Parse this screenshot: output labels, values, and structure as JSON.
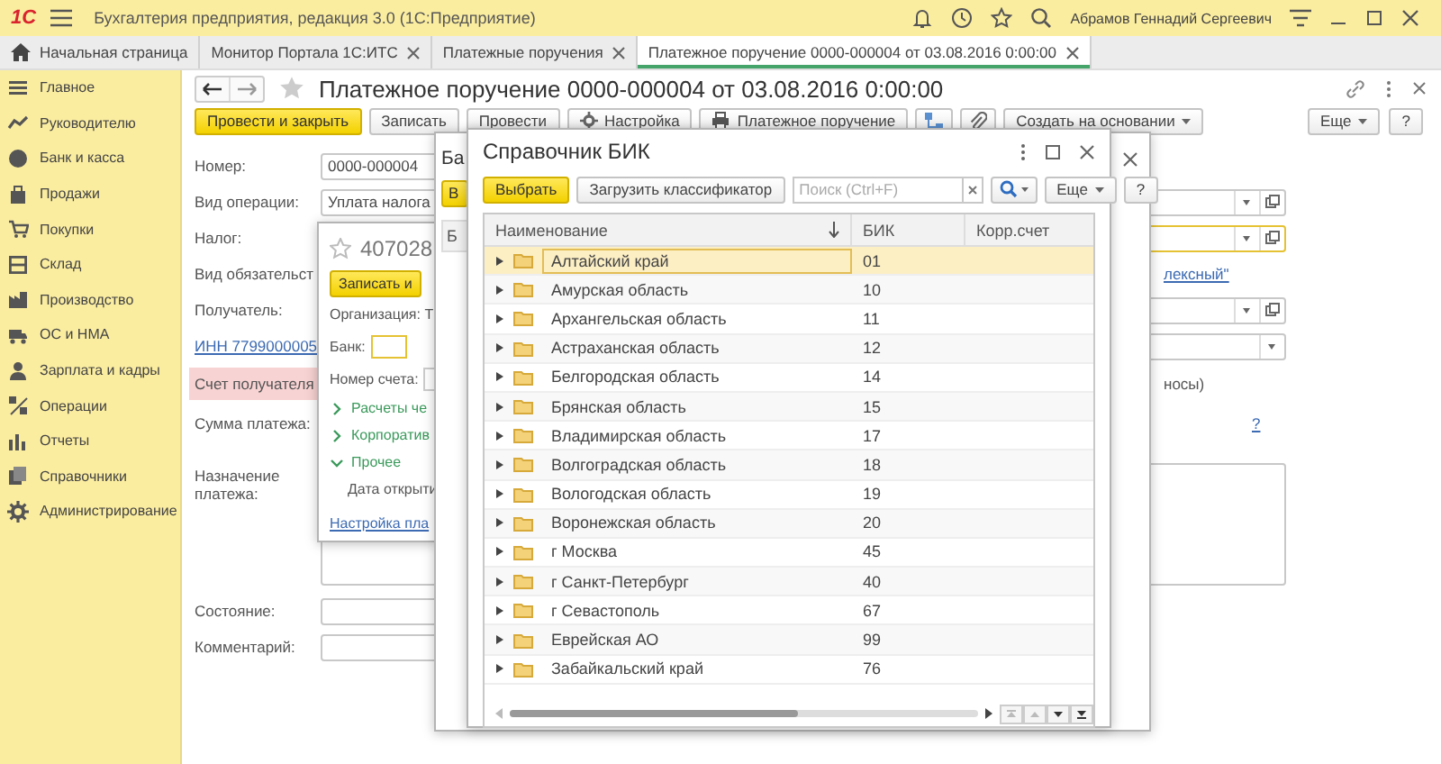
{
  "app": {
    "logo": "1С",
    "title": "Бухгалтерия предприятия, редакция 3.0  (1С:Предприятие)",
    "user": "Абрамов Геннадий Сергеевич"
  },
  "tabs": [
    {
      "label": "Начальная страница",
      "kind": "home",
      "selected": false
    },
    {
      "label": "Монитор Портала 1С:ИТС",
      "kind": "closable",
      "selected": false
    },
    {
      "label": "Платежные поручения",
      "kind": "closable",
      "selected": false
    },
    {
      "label": "Платежное поручение 0000-000004 от 03.08.2016 0:00:00",
      "kind": "closable",
      "selected": true
    }
  ],
  "sidebar": {
    "items": [
      {
        "label": "Главное"
      },
      {
        "label": "Руководителю"
      },
      {
        "label": "Банк и касса"
      },
      {
        "label": "Продажи"
      },
      {
        "label": "Покупки"
      },
      {
        "label": "Склад"
      },
      {
        "label": "Производство"
      },
      {
        "label": "ОС и НМА"
      },
      {
        "label": "Зарплата и кадры"
      },
      {
        "label": "Операции"
      },
      {
        "label": "Отчеты"
      },
      {
        "label": "Справочники"
      },
      {
        "label": "Администрирование"
      }
    ]
  },
  "document": {
    "title": "Платежное поручение 0000-000004 от 03.08.2016 0:00:00",
    "favorite": false,
    "toolbar": [
      {
        "label": "Провести и закрыть",
        "kind": "primary"
      },
      {
        "label": "Записать",
        "kind": "plain"
      },
      {
        "label": "Провести",
        "kind": "plain"
      },
      {
        "label": "Настройка",
        "kind": "gear"
      },
      {
        "label": "Платежное поручение",
        "kind": "print"
      },
      {
        "kind": "structure"
      },
      {
        "kind": "clip"
      },
      {
        "label": "Создать на основании",
        "kind": "menu"
      }
    ],
    "toolbar_right": [
      {
        "label": "Еще",
        "kind": "menu"
      },
      {
        "label": "?",
        "kind": "plain"
      }
    ],
    "fields": [
      {
        "kind": "input",
        "label": "Номер:",
        "value": "0000-000004"
      },
      {
        "kind": "select",
        "label": "Вид операции:",
        "value": "Уплата налога",
        "focused": false
      },
      {
        "kind": "select",
        "label": "Налог:",
        "focused": true
      },
      {
        "kind": "link",
        "label": "Вид обязательст",
        "link": "лексный\""
      },
      {
        "kind": "select",
        "label": "Получатель:",
        "focused": false
      },
      {
        "kind": "inn",
        "label": "ИНН 7799000005"
      },
      {
        "kind": "warning",
        "label": "Счет получателя",
        "note": "носы)"
      },
      {
        "kind": "help",
        "label": "Сумма платежа:",
        "help": "?"
      },
      {
        "kind": "textarea",
        "label": "Назначение платежа:"
      },
      {
        "kind": "short",
        "label": "Состояние:"
      },
      {
        "kind": "short",
        "label": "Комментарий:"
      }
    ]
  },
  "account_window": {
    "title": "407028",
    "button": "Записать и",
    "fields": [
      {
        "kind": "text",
        "label": "Организация: Т"
      },
      {
        "kind": "input",
        "label": "Банк:",
        "focused": true
      },
      {
        "kind": "input",
        "label": "Номер счета:",
        "focused": false
      }
    ],
    "groups": [
      {
        "label": "Расчеты че",
        "expanded": false
      },
      {
        "label": "Корпоратив",
        "expanded": false
      },
      {
        "label": "Прочее",
        "expanded": true,
        "children": [
          {
            "label": "Дата открыти"
          }
        ]
      }
    ],
    "link": "Настройка пла"
  },
  "bank_window": {
    "title": "Ба",
    "button": "В",
    "column": "Б"
  },
  "bik_window": {
    "title": "Справочник БИК",
    "buttons": [
      {
        "label": "Выбрать",
        "kind": "primary"
      },
      {
        "label": "Загрузить классификатор",
        "kind": "plain"
      }
    ],
    "search": {
      "placeholder": "Поиск (Ctrl+F)"
    },
    "tools": [
      {
        "label": "Еще",
        "kind": "menu"
      },
      {
        "label": "?",
        "kind": "plain"
      }
    ],
    "columns": [
      {
        "label": "Наименование",
        "sorted": true
      },
      {
        "label": "БИК",
        "sorted": false
      },
      {
        "label": "Корр.счет",
        "sorted": false
      }
    ],
    "rows": [
      {
        "name": "Алтайский край",
        "bik": "01",
        "selected": true
      },
      {
        "name": "Амурская область",
        "bik": "10",
        "selected": false
      },
      {
        "name": "Архангельская область",
        "bik": "11",
        "selected": false
      },
      {
        "name": "Астраханская область",
        "bik": "12",
        "selected": false
      },
      {
        "name": "Белгородская область",
        "bik": "14",
        "selected": false
      },
      {
        "name": "Брянская область",
        "bik": "15",
        "selected": false
      },
      {
        "name": "Владимирская область",
        "bik": "17",
        "selected": false
      },
      {
        "name": "Волгоградская область",
        "bik": "18",
        "selected": false
      },
      {
        "name": "Вологодская область",
        "bik": "19",
        "selected": false
      },
      {
        "name": "Воронежская область",
        "bik": "20",
        "selected": false
      },
      {
        "name": "г Москва",
        "bik": "45",
        "selected": false
      },
      {
        "name": "г Санкт-Петербург",
        "bik": "40",
        "selected": false
      },
      {
        "name": "г Севастополь",
        "bik": "67",
        "selected": false
      },
      {
        "name": "Еврейская АО",
        "bik": "99",
        "selected": false
      },
      {
        "name": "Забайкальский край",
        "bik": "76",
        "selected": false
      }
    ]
  }
}
